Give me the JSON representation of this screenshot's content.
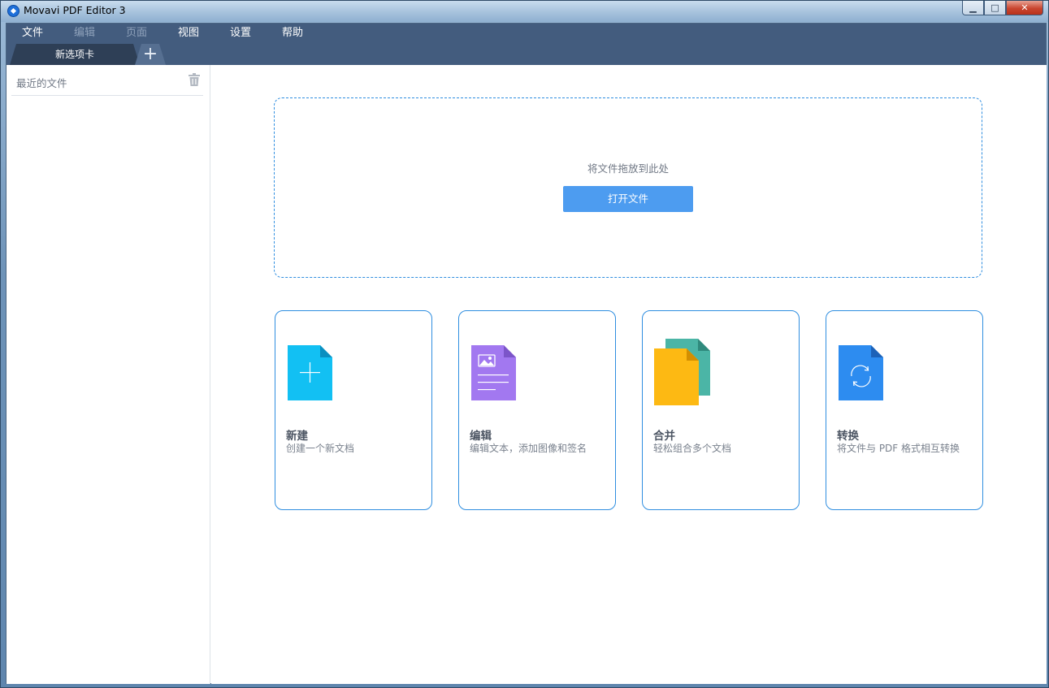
{
  "window": {
    "title": "Movavi PDF Editor 3",
    "buttons": {
      "minimize": "▁",
      "maximize": "□",
      "close": "✕"
    }
  },
  "menu": [
    {
      "label": "文件",
      "enabled": true
    },
    {
      "label": "编辑",
      "enabled": false
    },
    {
      "label": "页面",
      "enabled": false
    },
    {
      "label": "视图",
      "enabled": true
    },
    {
      "label": "设置",
      "enabled": true
    },
    {
      "label": "帮助",
      "enabled": true
    }
  ],
  "tabs": {
    "active_label": "新选项卡",
    "add_label": "+"
  },
  "sidebar": {
    "title": "最近的文件",
    "clear_icon": "trash-icon"
  },
  "dropzone": {
    "hint": "将文件拖放到此处",
    "open_button": "打开文件"
  },
  "cards": [
    {
      "id": "new",
      "title": "新建",
      "desc": "创建一个新文档",
      "icon": "new-document-icon",
      "color": "#12c0f3"
    },
    {
      "id": "edit",
      "title": "编辑",
      "desc": "编辑文本，添加图像和签名",
      "icon": "edit-document-icon",
      "color": "#a278f0"
    },
    {
      "id": "merge",
      "title": "合并",
      "desc": "轻松组合多个文档",
      "icon": "merge-documents-icon",
      "color": "#fdb913"
    },
    {
      "id": "convert",
      "title": "转换",
      "desc": "将文件与 PDF 格式相互转换",
      "icon": "convert-document-icon",
      "color": "#2d8cf0"
    }
  ],
  "colors": {
    "accent": "#2f8ee0",
    "menubar": "#435c7e",
    "button": "#4d9cf0"
  }
}
